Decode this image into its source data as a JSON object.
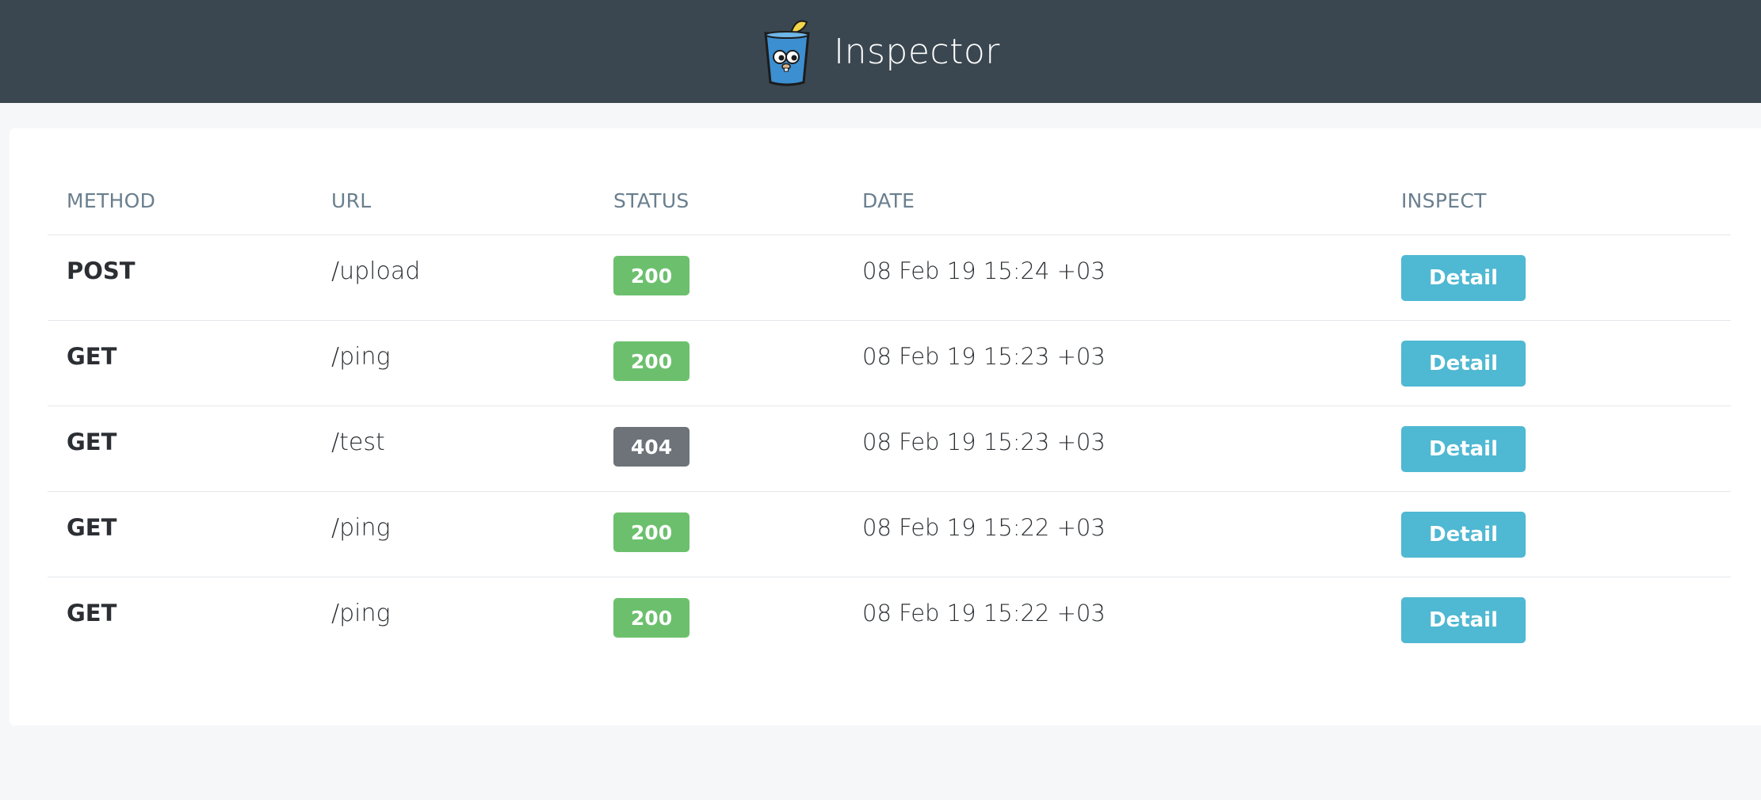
{
  "app": {
    "title": "Inspector",
    "logo_icon": "gopher-cup-icon"
  },
  "colors": {
    "navbar": "#3a4750",
    "status_ok": "#6cc06d",
    "status_error": "#6e7379",
    "detail_button": "#4fb8d2"
  },
  "table": {
    "headers": {
      "method": "METHOD",
      "url": "URL",
      "status": "STATUS",
      "date": "DATE",
      "inspect": "INSPECT"
    },
    "rows": [
      {
        "method": "POST",
        "url": "/upload",
        "status": "200",
        "status_kind": "ok",
        "date": "08 Feb 19 15:24 +03",
        "action": "Detail"
      },
      {
        "method": "GET",
        "url": "/ping",
        "status": "200",
        "status_kind": "ok",
        "date": "08 Feb 19 15:23 +03",
        "action": "Detail"
      },
      {
        "method": "GET",
        "url": "/test",
        "status": "404",
        "status_kind": "err",
        "date": "08 Feb 19 15:23 +03",
        "action": "Detail"
      },
      {
        "method": "GET",
        "url": "/ping",
        "status": "200",
        "status_kind": "ok",
        "date": "08 Feb 19 15:22 +03",
        "action": "Detail"
      },
      {
        "method": "GET",
        "url": "/ping",
        "status": "200",
        "status_kind": "ok",
        "date": "08 Feb 19 15:22 +03",
        "action": "Detail"
      }
    ]
  }
}
